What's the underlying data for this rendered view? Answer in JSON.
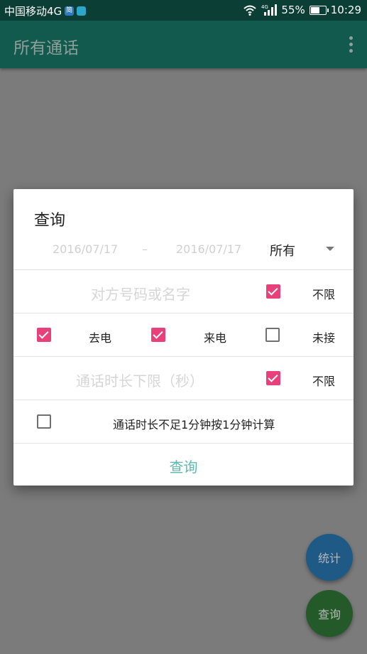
{
  "status_bar": {
    "carrier": "中国移动4G",
    "badge1": "简",
    "badge2": "",
    "network": "4G",
    "battery": "55%",
    "battery_level": 0.55,
    "time": "10:29"
  },
  "appbar": {
    "title": "所有通话"
  },
  "dialog": {
    "title": "查询",
    "date_from": "2016/07/17",
    "date_sep": "–",
    "date_to": "2016/07/17",
    "scope_value": "所有",
    "contact_placeholder": "对方号码或名字",
    "contact_unlimited": {
      "label": "不限",
      "checked": true
    },
    "outgoing": {
      "label": "去电",
      "checked": true
    },
    "incoming": {
      "label": "来电",
      "checked": true
    },
    "missed": {
      "label": "未接",
      "checked": false
    },
    "duration_placeholder": "通话时长下限（秒）",
    "duration_unlimited": {
      "label": "不限",
      "checked": true
    },
    "round_up": {
      "label": "通话时长不足1分钟按1分钟计算",
      "checked": false
    },
    "query_button": "查询"
  },
  "fabs": {
    "stats": "统计",
    "query": "查询"
  },
  "colors": {
    "status_bar": "#0b3f36",
    "appbar": "#135a4e",
    "checkbox_checked": "#e8417a",
    "accent_text": "#5fb8b0"
  }
}
